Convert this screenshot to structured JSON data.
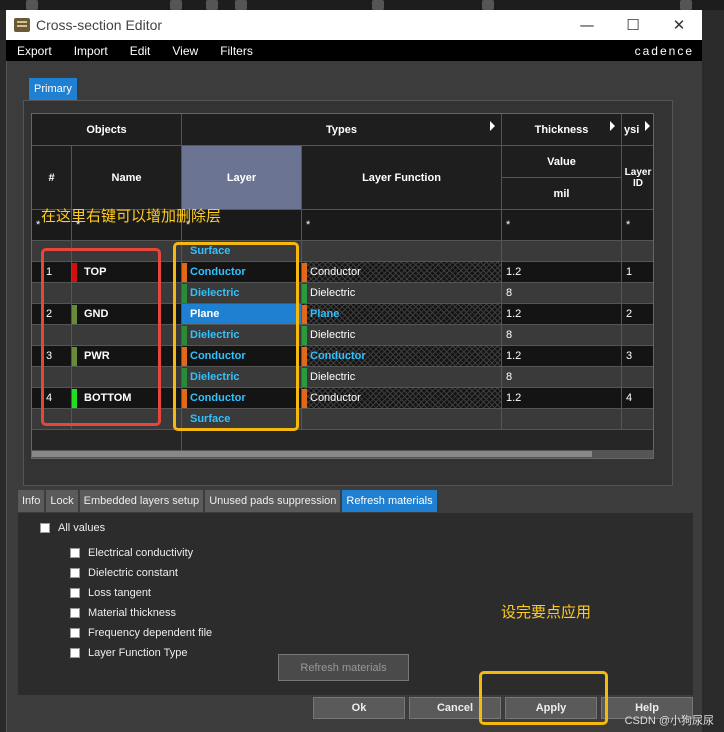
{
  "window": {
    "title": "Cross-section Editor",
    "minimize": "—",
    "maximize": "☐",
    "close": "✕"
  },
  "menu": {
    "items": [
      "Export",
      "Import",
      "Edit",
      "View",
      "Filters"
    ],
    "brand": "cadence"
  },
  "primary_tab": "Primary",
  "table": {
    "headers": {
      "objects": "Objects",
      "types": "Types",
      "thickness": "Thickness",
      "physical": "ysi",
      "num": "#",
      "name": "Name",
      "layer": "Layer",
      "layer_function": "Layer Function",
      "value": "Value",
      "unit": "mil",
      "layer_id": "Layer ID"
    },
    "filter": "*",
    "rows": [
      {
        "num": "",
        "name": "",
        "name_color": "",
        "layer": "Surface",
        "layer_color": "",
        "func": "",
        "func_color": "",
        "thickness": "",
        "id": "",
        "style": "lt"
      },
      {
        "num": "1",
        "name": "TOP",
        "name_color": "#d01010",
        "layer": "Conductor",
        "layer_color": "#e06a1a",
        "func": "Conductor",
        "func_color": "#e06a1a",
        "thickness": "1.2",
        "id": "1",
        "style": "dk",
        "hatch": true
      },
      {
        "num": "",
        "name": "",
        "name_color": "",
        "layer": "Dielectric",
        "layer_color": "#2a8a3a",
        "func": "Dielectric",
        "func_color": "#2a9a3a",
        "thickness": "8",
        "id": "",
        "style": "lt"
      },
      {
        "num": "2",
        "name": "GND",
        "name_color": "#6a8a3a",
        "layer": "Plane",
        "layer_color": "#e06a1a",
        "func": "Plane",
        "func_color": "#e06a1a",
        "thickness": "1.2",
        "id": "2",
        "style": "dk",
        "hatch": true,
        "selected_layer": true
      },
      {
        "num": "",
        "name": "",
        "name_color": "",
        "layer": "Dielectric",
        "layer_color": "#2a8a3a",
        "func": "Dielectric",
        "func_color": "#2a9a3a",
        "thickness": "8",
        "id": "",
        "style": "lt"
      },
      {
        "num": "3",
        "name": "PWR",
        "name_color": "#6a8a3a",
        "layer": "Conductor",
        "layer_color": "#e06a1a",
        "func": "Conductor",
        "func_color": "#e06a1a",
        "thickness": "1.2",
        "id": "3",
        "style": "dk",
        "hatch": true,
        "func_blue": true
      },
      {
        "num": "",
        "name": "",
        "name_color": "",
        "layer": "Dielectric",
        "layer_color": "#2a8a3a",
        "func": "Dielectric",
        "func_color": "#2a9a3a",
        "thickness": "8",
        "id": "",
        "style": "lt"
      },
      {
        "num": "4",
        "name": "BOTTOM",
        "name_color": "#22dd22",
        "layer": "Conductor",
        "layer_color": "#e06a1a",
        "func": "Conductor",
        "func_color": "#e06a1a",
        "thickness": "1.2",
        "id": "4",
        "style": "dk",
        "hatch": true
      },
      {
        "num": "",
        "name": "",
        "name_color": "",
        "layer": "Surface",
        "layer_color": "",
        "func": "",
        "func_color": "",
        "thickness": "",
        "id": "",
        "style": "lt"
      }
    ]
  },
  "bottom_tabs": [
    "Info",
    "Lock",
    "Embedded layers setup",
    "Unused pads suppression",
    "Refresh materials"
  ],
  "options": {
    "all_values": "All values",
    "items": [
      "Electrical conductivity",
      "Dielectric constant",
      "Loss tangent",
      "Material thickness",
      "Frequency dependent file",
      "Layer Function Type"
    ]
  },
  "buttons": {
    "refresh": "Refresh materials",
    "ok": "Ok",
    "cancel": "Cancel",
    "apply": "Apply",
    "help": "Help"
  },
  "annotations": {
    "right_click": "在这里右键可以增加删除层",
    "apply_hint": "设完要点应用"
  },
  "watermark": "CSDN @小狗尿尿",
  "colors": {
    "accent": "#1f7fd1",
    "annotation_red": "#e8453c",
    "annotation_yellow": "#f5b80e"
  }
}
